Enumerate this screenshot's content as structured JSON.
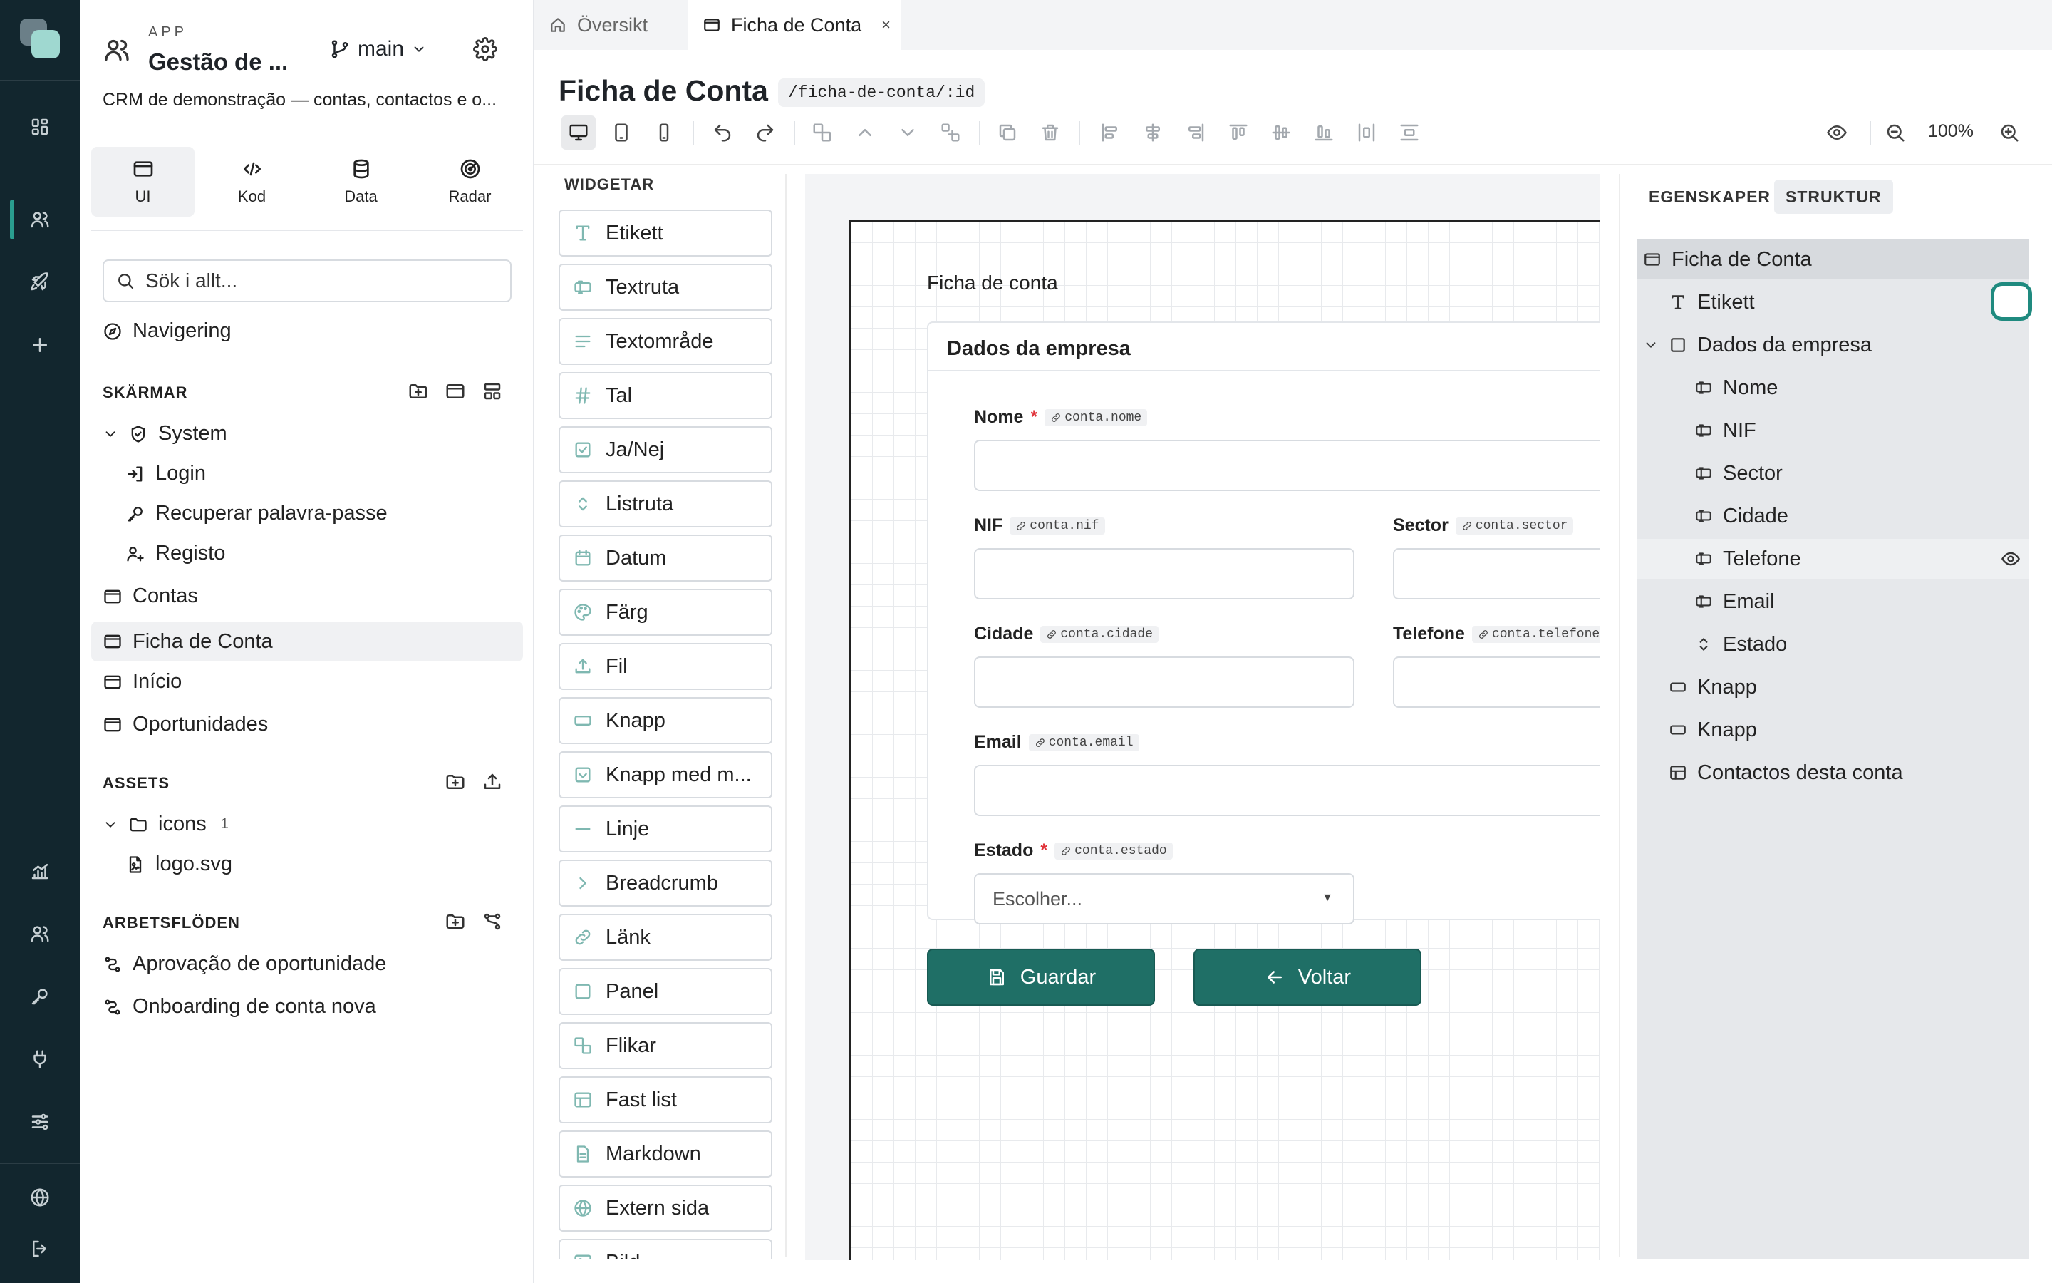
{
  "rail": {
    "items": [
      "dashboard-icon",
      "users-icon",
      "rocket-icon",
      "plus-icon"
    ],
    "bottom_items": [
      "chart-icon",
      "team-icon",
      "key-icon",
      "plug-icon",
      "sliders-icon",
      "globe-icon",
      "logout-icon"
    ]
  },
  "app": {
    "kicker": "APP",
    "title": "Gestão de ...",
    "branch": "main",
    "description": "CRM de demonstração — contas, contactos e o..."
  },
  "mode_tabs": [
    {
      "label": "UI",
      "icon": "window-icon"
    },
    {
      "label": "Kod",
      "icon": "code-icon"
    },
    {
      "label": "Data",
      "icon": "database-icon"
    },
    {
      "label": "Radar",
      "icon": "radar-icon"
    }
  ],
  "search": {
    "placeholder": "Sök i allt..."
  },
  "navigation": {
    "label": "Navigering"
  },
  "screens": {
    "header": "SKÄRMAR",
    "system": {
      "label": "System",
      "children": [
        "Login",
        "Recuperar palavra-passe",
        "Registo"
      ]
    },
    "items": [
      "Contas",
      "Ficha de Conta",
      "Início",
      "Oportunidades"
    ]
  },
  "assets": {
    "header": "ASSETS",
    "folder": {
      "label": "icons",
      "count": "1"
    },
    "files": [
      "logo.svg"
    ]
  },
  "workflows": {
    "header": "ARBETSFLÖDEN",
    "items": [
      "Aprovação de oportunidade",
      "Onboarding de conta nova"
    ]
  },
  "tabs": [
    {
      "label": "Översikt",
      "icon": "home-icon"
    },
    {
      "label": "Ficha de Conta",
      "icon": "window-icon",
      "close": "×"
    }
  ],
  "page": {
    "title": "Ficha de Conta",
    "route": "/ficha-de-conta/:id"
  },
  "toolbar": {
    "zoom": "100%"
  },
  "palette": {
    "header": "WIDGETAR",
    "items": [
      "Etikett",
      "Textruta",
      "Textområde",
      "Tal",
      "Ja/Nej",
      "Listruta",
      "Datum",
      "Färg",
      "Fil",
      "Knapp",
      "Knapp med m...",
      "Linje",
      "Breadcrumb",
      "Länk",
      "Panel",
      "Flikar",
      "Fast list",
      "Markdown",
      "Extern sida",
      "Bild"
    ]
  },
  "canvas": {
    "label": "Ficha de conta",
    "panel_title": "Dados da empresa",
    "fields": {
      "nome": {
        "label": "Nome",
        "required": "*",
        "binding": "conta.nome"
      },
      "nif": {
        "label": "NIF",
        "binding": "conta.nif"
      },
      "sector": {
        "label": "Sector",
        "binding": "conta.sector"
      },
      "cidade": {
        "label": "Cidade",
        "binding": "conta.cidade"
      },
      "telefone": {
        "label": "Telefone",
        "binding": "conta.telefone"
      },
      "email": {
        "label": "Email",
        "binding": "conta.email"
      },
      "estado": {
        "label": "Estado",
        "required": "*",
        "binding": "conta.estado",
        "placeholder": "Escolher..."
      }
    },
    "buttons": {
      "save": "Guardar",
      "back": "Voltar"
    }
  },
  "right_panel": {
    "tabs": [
      "EGENSKAPER",
      "STRUKTUR"
    ],
    "tree": [
      {
        "label": "Ficha de Conta",
        "icon": "window-icon"
      },
      {
        "label": "Etikett",
        "icon": "text-icon"
      },
      {
        "label": "Dados da empresa",
        "icon": "panel-icon"
      },
      {
        "label": "Nome",
        "icon": "input-icon"
      },
      {
        "label": "NIF",
        "icon": "input-icon"
      },
      {
        "label": "Sector",
        "icon": "input-icon"
      },
      {
        "label": "Cidade",
        "icon": "input-icon"
      },
      {
        "label": "Telefone",
        "icon": "input-icon"
      },
      {
        "label": "Email",
        "icon": "input-icon"
      },
      {
        "label": "Estado",
        "icon": "select-icon"
      },
      {
        "label": "Knapp",
        "icon": "button-icon"
      },
      {
        "label": "Knapp",
        "icon": "button-icon"
      },
      {
        "label": "Contactos desta conta",
        "icon": "table-icon"
      }
    ]
  },
  "colors": {
    "accent": "#1f6f66",
    "rail": "#12262e",
    "required": "#e0333a"
  }
}
